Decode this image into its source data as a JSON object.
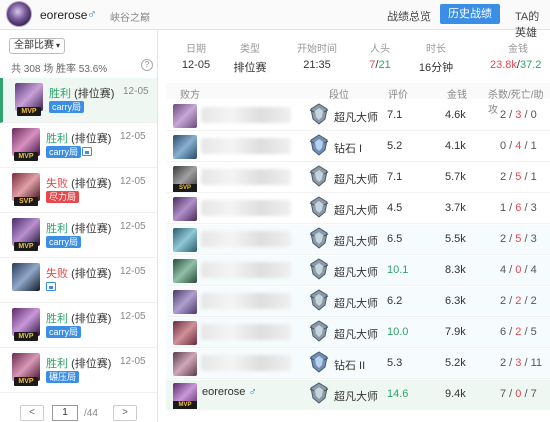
{
  "topbar": {
    "username": "eorerose",
    "gender_icon": "♂",
    "server": "峡谷之巅",
    "tabs": [
      {
        "label": "战绩总览",
        "active": false
      },
      {
        "label": "历史战绩",
        "active": true
      },
      {
        "label": "TA的英雄",
        "active": false
      }
    ]
  },
  "sidebar": {
    "filter_label": "全部比赛",
    "summary": "共 308 场  胜率 53.6%",
    "help": "?",
    "matches": [
      {
        "result": "胜利",
        "mode": "(排位赛)",
        "date": "12-05",
        "tag": "carry局",
        "badge": "MVP",
        "win": true,
        "active": true
      },
      {
        "result": "胜利",
        "mode": "(排位赛)",
        "date": "12-05",
        "tag": "carry局",
        "badge": "MVP",
        "win": true
      },
      {
        "result": "失败",
        "mode": "(排位赛)",
        "date": "12-05",
        "tag": "尽力局",
        "badge": "SVP",
        "win": false
      },
      {
        "result": "胜利",
        "mode": "(排位赛)",
        "date": "12-05",
        "tag": "carry局",
        "badge": "MVP",
        "win": true
      },
      {
        "result": "失败",
        "mode": "(排位赛)",
        "date": "12-05",
        "tag": "",
        "badge": "",
        "win": false
      },
      {
        "result": "胜利",
        "mode": "(排位赛)",
        "date": "12-05",
        "tag": "carry局",
        "badge": "MVP",
        "win": true
      },
      {
        "result": "胜利",
        "mode": "(排位赛)",
        "date": "12-05",
        "tag": "碾压局",
        "badge": "MVP",
        "win": true
      }
    ],
    "pager": {
      "prev": "<",
      "page": "1",
      "total": "/44",
      "next": ">"
    }
  },
  "match_summary": {
    "date_label": "日期",
    "date": "12-05",
    "type_label": "类型",
    "type": "排位赛",
    "start_label": "开始时间",
    "start": "21:35",
    "kills_label": "人头",
    "kills_a": "7",
    "kills_b": "21",
    "duration_label": "时长",
    "duration": "16分钟",
    "gold_label": "金钱",
    "gold_a": "23.8k",
    "gold_b": "37.2"
  },
  "table": {
    "headers": {
      "team": "败方",
      "rank": "段位",
      "score": "评价",
      "gold": "金钱",
      "kda": "杀数/死亡/助攻"
    },
    "rows": [
      {
        "name": "",
        "rank": "超凡大师",
        "score": "7.1",
        "gold": "4.6k",
        "k": "2",
        "d": "3",
        "a": "0"
      },
      {
        "name": "",
        "rank": "钻石 I",
        "score": "5.2",
        "gold": "4.1k",
        "k": "0",
        "d": "4",
        "a": "1"
      },
      {
        "name": "",
        "rank": "超凡大师",
        "score": "7.1",
        "gold": "5.7k",
        "k": "2",
        "d": "5",
        "a": "1",
        "badge": "SVP"
      },
      {
        "name": "",
        "rank": "超凡大师",
        "score": "4.5",
        "gold": "3.7k",
        "k": "1",
        "d": "6",
        "a": "3"
      },
      {
        "name": "",
        "rank": "超凡大师",
        "score": "6.5",
        "gold": "5.5k",
        "k": "2",
        "d": "5",
        "a": "3"
      },
      {
        "name": "",
        "rank": "超凡大师",
        "score": "10.1",
        "gold": "8.3k",
        "k": "4",
        "d": "0",
        "a": "4"
      },
      {
        "name": "",
        "rank": "超凡大师",
        "score": "6.2",
        "gold": "6.3k",
        "k": "2",
        "d": "2",
        "a": "2"
      },
      {
        "name": "",
        "rank": "超凡大师",
        "score": "10.0",
        "gold": "7.9k",
        "k": "6",
        "d": "2",
        "a": "5"
      },
      {
        "name": "",
        "rank": "钻石 II",
        "score": "5.3",
        "gold": "5.2k",
        "k": "2",
        "d": "3",
        "a": "11"
      },
      {
        "name": "eorerose",
        "gender": "♂",
        "rank": "超凡大师",
        "score": "14.6",
        "gold": "9.4k",
        "k": "7",
        "d": "0",
        "a": "7",
        "badge": "MVP",
        "mine": true
      }
    ]
  },
  "colors": {
    "win": "#2fa36b",
    "lose": "#e5484d",
    "accent": "#3a8ee6"
  }
}
